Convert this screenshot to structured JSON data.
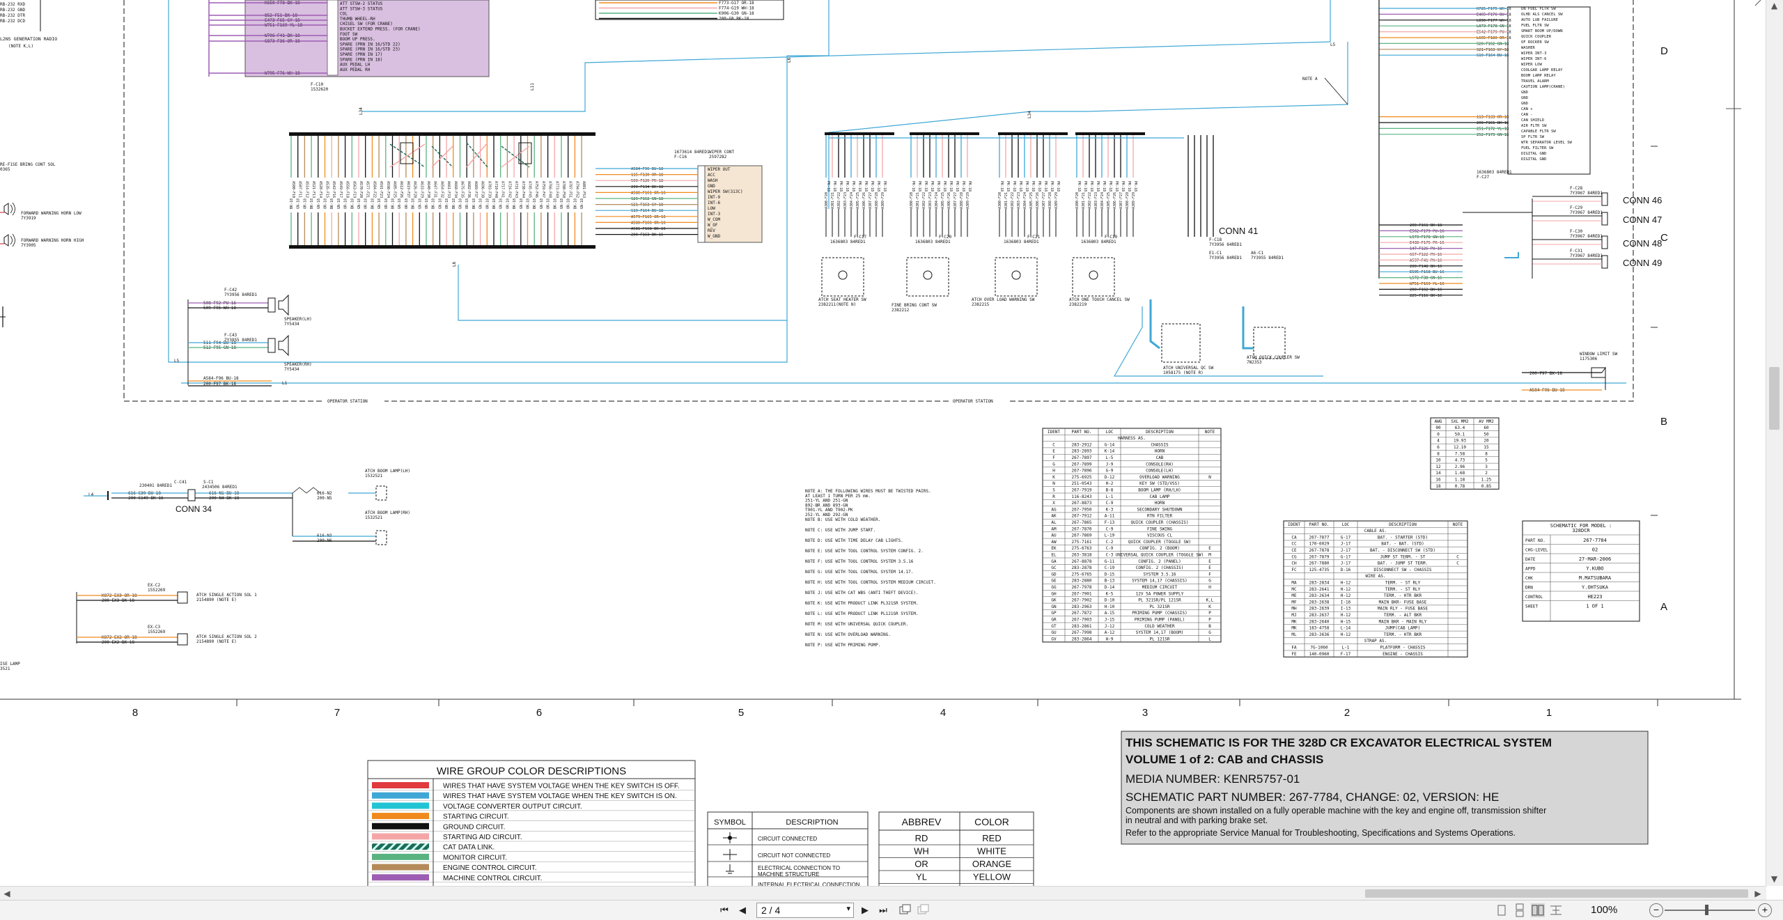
{
  "wire_colors": {
    "red": "#e0393e",
    "blue": "#3fa7d6",
    "cyan": "#22c4d4",
    "orange": "#f08a1c",
    "black": "#111111",
    "pink": "#f4a6a6",
    "dashed": "#1a6b5a",
    "green": "#59b380",
    "brown": "#b58a5a",
    "purple": "#9d5db3"
  },
  "fragments": {
    "top_left": [
      "RB-232 RXD",
      "RB-232 GND",
      "RB-232 DTR",
      "RB-232 DCD",
      "L2NS GENERATION RADIO",
      "(NOTE K,L)"
    ],
    "purple_labels": [
      "ATT STSW-2 STATUS",
      "ATT STSW-3 STATUS",
      "COL",
      "THUMB WHEEL-RH",
      "CHISEL SW (FOR CRANE)",
      "BUCKET EXTEND PRESS. (FOR CRANE)",
      "FOOT SW",
      "BOOM UP PRESS.",
      "SPARE (PRN IN 16/STD 22)",
      "SPARE (PRN IN 16/STD 23)",
      "SPARE (PRN IN 17)",
      "SPARE (PRN IN 18)",
      "AUX PEDAL LH",
      "AUX PEDAL RH"
    ],
    "purple_wires": [
      "K650-F73  BK-18",
      "852-F51  BK-18",
      "E473-F65  GY-18",
      "W751-F169  YL-18",
      "W706-F41  BK-18",
      "G873-F36  OR-18",
      "W795-F76  WH-18"
    ],
    "purple_ref": [
      "F-C10",
      "1532620"
    ],
    "top_middle": [
      "F773-G17  OR-18",
      "F774-G19  WH-18",
      "K906-G30  GN-18",
      "200-G8  BK-18"
    ],
    "left_side": [
      "RE-F1SE BRING CONT SOL",
      "0365",
      "FORWARD WARNING HORN LOW",
      "7Y3919",
      "FORWARD WARNING HORN HIGH",
      "7Y3905"
    ],
    "wiper_cont": [
      "WIPER CONT",
      "2597282",
      "1673614 84RED1",
      "F-C16"
    ],
    "wiper_pins": [
      "WIPER OUT",
      "ACC",
      "WASH",
      "GND",
      "WIPER SW(313C)",
      "INT-9",
      "INT-6",
      "LOW",
      "INT-3",
      "W_COM",
      "W_OF",
      "REV",
      "W_GND"
    ],
    "wiper_wires": [
      "A584-F96  BU-18",
      "115-F130  OR-18",
      "500-F130  PK-18",
      "200-F134  BK-18",
      "A586-F161  OR-16",
      "S20-F162  GN-18",
      "S21-F163  GY-18",
      "S19-F164  BU-18",
      "A579-F165  OR-16",
      "A580-F166  OR-16",
      "A581-F168  BK-16",
      "200-F163  BK-16"
    ],
    "speakers": [
      "F-C42",
      "7Y3956 84RED1",
      "508-F92  PU-16",
      "509-F95  WH-18",
      "SPEAKER(LH)",
      "7Y5434",
      "F-C43",
      "7Y3955 84RED1",
      "511-F94  BU-18",
      "512-F95  GN-18",
      "SPEAKER(RH)",
      "7Y5434",
      "A584-F96  BU-18",
      "200-F97  BK-18"
    ],
    "switches": [
      "ATCH SEAT HEATER SW",
      "2382211(NOTE N)",
      "FINE BRING CONT SW",
      "2382212",
      "ATCH OVER LOAD WARNING SW",
      "2382215",
      "ATCH ONE TOUCH CANCEL SW",
      "2382219"
    ],
    "switch_refs": [
      "F-C17",
      "1636803 84RED1",
      "F-C20",
      "1636803 84RED1",
      "F-C21",
      "1636803 84RED1",
      "F-C19",
      "1636803 84RED1"
    ],
    "conn41": "CONN 41",
    "conn41_refs": [
      "F-C18",
      "7Y3956 84RED1",
      "E1-C1",
      "7Y3956 84RED1",
      "A6-C1",
      "7Y3955 84RED1"
    ],
    "attach_sw": [
      "ATCH UNIVERSAL QC SW",
      "1058175 (NOTE R)",
      "ATCH QUICK COUPLER SW",
      "7N2353"
    ],
    "operator_station": "OPERATOR STATION",
    "right_labels": [
      "EN FUEL FLTR SW",
      "OLHD ALS CANCEL SW",
      "AUTO LUB FAILURE",
      "FUEL FLTR SW",
      "SMART BOOM UP/DOWN",
      "QUICK COUPLER",
      "OF ROCKER SW",
      "WASHER",
      "WIPER INT-3",
      "WIPER INT-6",
      "WIPER LOW",
      "COOLGAR LAMP RELAY",
      "BOOM LAMP RELAY",
      "TRAVEL ALARM",
      "CAUTION LAMP(CRANE)",
      "GND",
      "GND",
      "GND",
      "CAN +",
      "CAN -",
      "CAN SHIELD",
      "AIR FLTR SW",
      "CAPABLE FLTR SW",
      "SP FLTR SW",
      "WTR SEPARATOR LEVEL SW",
      "FUEL FILTER SW",
      "DIGITAL GND",
      "DIGITAL GND"
    ],
    "right_wires": [
      "K725-F175  WH-18",
      "E465-F176  BU-18",
      "L896-F177  WH-18",
      "L873-F178  GN-18",
      "E542-F179  PU-18",
      "L665-F180  OR-18",
      "S20-F162  GN-18",
      "S21-F163  GY-18",
      "S19-F164  BU-18",
      "113-F133  OR-18",
      "200-F161  BK-18",
      "251-F172  YL-18",
      "252-F173  GN-18"
    ],
    "note_a": "NOTE A",
    "conn_refs_right": [
      "F-C27",
      "1636803 84RED1",
      "F-C28",
      "7Y3967 84RED1",
      "F-C29",
      "7Y3967 84RED1",
      "F-C30",
      "7Y3967 84RED1",
      "F-C31",
      "7Y3967 84RED1"
    ],
    "right_lower_wires": [
      "200-F161  BK-18",
      "E562-F179  PU-16",
      "L573-F178  GN-16",
      "E438-F175  PK-16",
      "147-F126  PU-16",
      "667-F122  PK-16",
      "A537-F41  PK-16",
      "200-F148  BK-16",
      "E505-F168  BU-16",
      "L572-F38  GN-16",
      "W751-F169  YL-16",
      "200-F162  BK-16",
      "225-F116  BK-16"
    ],
    "conn_right": [
      "CONN 46",
      "CONN 47",
      "CONN 48",
      "CONN 49"
    ],
    "window_limit": [
      "WINDOW LIMIT SW",
      "1175306",
      "200-F97  BK-18",
      "A584-F96  BU-18"
    ],
    "conn34": "CONN 34",
    "conn34_wires": [
      "230401 84RED1",
      "616-C30  BU-18",
      "200-C149  BK-16",
      "C-C41",
      "2434506 84RED1",
      "S-C1",
      "616-N1  BU-18",
      "200-N4  BK-18",
      "616-N2",
      "200-N5",
      "616-N3",
      "200-N6"
    ],
    "boom_lamps": [
      "ATCH BOOM LAMP(LH)",
      "1532521",
      "ATCH BOOM LAMP(RH)",
      "1532521"
    ],
    "sols": [
      "EX-C2",
      "1552269",
      "K872-EX3  OR-18",
      "200-EX3  BK-18",
      "ATCH SINGLE ACTION SOL 1",
      "2154890  (NOTE E)",
      "EX-C3",
      "1552269",
      "K872-EX2  OR-18",
      "200-EX2  BK-18",
      "ATCH SINGLE ACTION SOL 2",
      "2154890  (NOTE E)"
    ],
    "lamp_left": [
      "ISE LAMP",
      "3521"
    ],
    "ref_l_labels": [
      "L1",
      "L5",
      "L6",
      "L6",
      "L5",
      "L4",
      "L34",
      "L34"
    ],
    "zone_letters": [
      "D",
      "C",
      "B",
      "A"
    ],
    "grid_numbers": [
      "8",
      "7",
      "6",
      "5",
      "4",
      "3",
      "2",
      "1"
    ]
  },
  "notes": [
    "NOTE A: THE FOLLOWING WIRES MUST BE TWISTED PAIRS.",
    "    AT LEAST 1 TURN PER 25 mm.",
    "    251-YL AND 251-GN",
    "    892-BR AND 893-GN",
    "    T901-YL AND T902-PK",
    "    252-YL AND 292-GN",
    "NOTE B: USE WITH COLD WEATHER.",
    "NOTE C: USE WITH JUMP START.",
    "NOTE D: USE WITH TIME DELAY CAB LIGHTS.",
    "NOTE E: USE WITH TOOL CONTROL SYSTEM CONFIG. 2.",
    "NOTE F: USE WITH TOOL CONTROL SYSTEM 3.5.16",
    "NOTE G: USE WITH TOOL CONTROL SYSTEM 14.17.",
    "NOTE H: USE WITH TOOL CONTROL SYSTEM MEDIUM CIRCUIT.",
    "NOTE J: USE WITH CAT WBS (ANTI THEFT DEVICE).",
    "NOTE K: USE WITH PRODUCT LINK PL321SR SYSTEM.",
    "NOTE L: USE WITH PRODUCT LINK PL121SR SYSTEM.",
    "NOTE M: USE WITH UNIVERSAL QUICK COUPLER.",
    "NOTE N: USE WITH OVERLOAD WARNING.",
    "NOTE P: USE WITH PRIMING PUMP."
  ],
  "harness_table": {
    "headers": [
      "IDENT",
      "PART NO.",
      "LOC",
      "DESCRIPTION",
      "NOTE"
    ],
    "section": "HARNESS AS.",
    "rows": [
      [
        "C",
        "283-2912",
        "G-14",
        "CHASSIS",
        ""
      ],
      [
        "E",
        "283-2893",
        "K-14",
        "HORN",
        ""
      ],
      [
        "F",
        "267-7897",
        "L-5",
        "CAB",
        ""
      ],
      [
        "G",
        "267-7899",
        "J-9",
        "CONSOLE(RH)",
        ""
      ],
      [
        "H",
        "267-7896",
        "G-9",
        "CONSOLE(LH)",
        ""
      ],
      [
        "K",
        "275-6925",
        "D-12",
        "OVERLOAD WARNING",
        "N"
      ],
      [
        "N",
        "251-0543",
        "H-2",
        "KEY SW (STD/VSS)",
        ""
      ],
      [
        "S",
        "267-7919",
        "B-8",
        "BOOM LAMP (RH/LH)",
        ""
      ],
      [
        "R",
        "116-8243",
        "L-1",
        "CAB LAMP",
        ""
      ],
      [
        "X",
        "267-8873",
        "C-9",
        "HORN",
        ""
      ],
      [
        "AG",
        "267-7950",
        "K-3",
        "SECONDARY SHUTDOWN",
        ""
      ],
      [
        "AK",
        "267-7912",
        "A-11",
        "RTN FILTER",
        ""
      ],
      [
        "AL",
        "267-7865",
        "F-13",
        "QUICK COUPLER (CHASSIS)",
        ""
      ],
      [
        "AM",
        "267-7870",
        "C-9",
        "FINE SWING",
        ""
      ],
      [
        "AU",
        "267-7869",
        "L-19",
        "VISCOUS CL",
        ""
      ],
      [
        "AW",
        "275-7161",
        "C-2",
        "QUICK COUPLER (TOGGLE SW)",
        ""
      ],
      [
        "EK",
        "275-6763",
        "C-9",
        "CONFIG. 2 (BOOM)",
        "E"
      ],
      [
        "EL",
        "263-3818",
        "C-3",
        "UNIVERSAL QUICK COUPLER (TOGGLE SW)",
        "M"
      ],
      [
        "GA",
        "267-8878",
        "G-11",
        "CONFIG. 2 (PANEL)",
        "E"
      ],
      [
        "GC",
        "283-2878",
        "C-19",
        "CONFIG. 2 (CHASSIS)",
        "E"
      ],
      [
        "GD",
        "275-6765",
        "D-15",
        "SYSTEM 3.5.16",
        "F"
      ],
      [
        "GE",
        "283-2880",
        "B-13",
        "SYSTEM 14,17 (CHASSIS)",
        "G"
      ],
      [
        "GG",
        "267-7978",
        "D-14",
        "MEDIUM CIRCUIT",
        "H"
      ],
      [
        "GH",
        "267-7901",
        "K-5",
        "12V 5A POWER SUPPLY",
        ""
      ],
      [
        "GK",
        "267-7902",
        "D-10",
        "PL 321SR/PL 121SR",
        "K,L"
      ],
      [
        "GN",
        "283-2963",
        "H-10",
        "PL 321SR",
        "K"
      ],
      [
        "GP",
        "267-7872",
        "A-15",
        "PRIMING PUMP (CHASSIS)",
        "P"
      ],
      [
        "GR",
        "267-7903",
        "J-15",
        "PRIMING PUMP (PANEL)",
        "P"
      ],
      [
        "GT",
        "283-2861",
        "J-12",
        "COLD WEATHER",
        "B"
      ],
      [
        "GU",
        "267-7998",
        "A-12",
        "SYSTEM 14,17 (BOOM)",
        "G"
      ],
      [
        "GV",
        "283-2864",
        "H-9",
        "PL 121SR",
        "L"
      ]
    ]
  },
  "awg_table": {
    "headers": [
      "AWG",
      "SXL MM2",
      "AV MM2"
    ],
    "rows": [
      [
        "00",
        "63.4",
        "60"
      ],
      [
        "0",
        "50.1",
        "50"
      ],
      [
        "4",
        "19.93",
        "20"
      ],
      [
        "6",
        "12.10",
        "15"
      ],
      [
        "8",
        "7.58",
        "8"
      ],
      [
        "10",
        "4.73",
        "5"
      ],
      [
        "12",
        "2.96",
        "3"
      ],
      [
        "14",
        "1.68",
        "2"
      ],
      [
        "16",
        "1.18",
        "1.25"
      ],
      [
        "18",
        "0.78",
        "0.85"
      ]
    ]
  },
  "cable_table": {
    "headers": [
      "IDENT",
      "PART NO.",
      "LOC",
      "DESCRIPTION",
      "NOTE"
    ],
    "sections": [
      {
        "title": "CABLE AS.",
        "rows": [
          [
            "CA",
            "267-7877",
            "G-17",
            "BAT. - STARTER (STD)",
            ""
          ],
          [
            "CC",
            "170-6029",
            "J-17",
            "BAT. - BAT. (STD)",
            ""
          ],
          [
            "CE",
            "267-7878",
            "J-17",
            "BAT. - DISCONNECT SW (STD)",
            ""
          ],
          [
            "CG",
            "267-7879",
            "G-17",
            "JUMP ST TERM. - ST",
            "C"
          ],
          [
            "CH",
            "267-7880",
            "J-17",
            "BAT. - JUMP ST TERM.",
            "C"
          ],
          [
            "FC",
            "125-4735",
            "D-16",
            "DISCONNECT SW - CHASSIS",
            ""
          ]
        ]
      },
      {
        "title": "WIRE AS.",
        "rows": [
          [
            "MA",
            "283-2834",
            "H-12",
            "TERM. - ST RLY",
            ""
          ],
          [
            "MC",
            "283-2641",
            "H-12",
            "TERM. - ST RLY",
            ""
          ],
          [
            "ME",
            "283-2634",
            "H-12",
            "TERM. - HTR BKR",
            ""
          ],
          [
            "MF",
            "283-2638",
            "I-16",
            "MAIN BKR- FUSE BASE",
            ""
          ],
          [
            "MH",
            "283-2639",
            "I-13",
            "MAIN RLY - FUSE BASE",
            ""
          ],
          [
            "MJ",
            "283-2637",
            "H-12",
            "TERM. - ALT BKR",
            ""
          ],
          [
            "MK",
            "283-2640",
            "H-15",
            "MAIN BKR - MAIN RLY",
            ""
          ],
          [
            "MK",
            "183-4758",
            "L-14",
            "JUMP(CAB LAMP)",
            ""
          ],
          [
            "ML",
            "283-2636",
            "H-12",
            "TERM. - HTR BKR",
            ""
          ]
        ]
      },
      {
        "title": "STRAP AS.",
        "rows": [
          [
            "FA",
            "7G-1060",
            "L-1",
            "PLATFORM - CHASSIS",
            ""
          ],
          [
            "FE",
            "140-0960",
            "F-17",
            "ENGINE - CHASSIS",
            ""
          ]
        ]
      }
    ]
  },
  "title_block": {
    "heading": "SCHEMATIC FOR MODEL :",
    "model": "328DCR",
    "rows": [
      [
        "PART NO.",
        "267-7784"
      ],
      [
        "CHG-LEVEL",
        "02"
      ],
      [
        "DATE",
        "27-MAR-2006"
      ],
      [
        "APPD",
        "Y.KUBO"
      ],
      [
        "CHK",
        "M.MATSUBARA"
      ],
      [
        "DRN",
        "Y.OHTSUKA"
      ],
      [
        "CONTROL",
        "HE223"
      ],
      [
        "SHEET",
        "1 OF 1"
      ]
    ]
  },
  "info_box": {
    "line1": "THIS SCHEMATIC IS FOR THE 328D CR EXCAVATOR ELECTRICAL SYSTEM",
    "line2": "VOLUME 1 of 2: CAB and CHASSIS",
    "line3": "MEDIA NUMBER: KENR5757-01",
    "line4": "SCHEMATIC PART NUMBER: 267-7784, CHANGE: 02, VERSION: HE",
    "line5": "Components are shown installed on a fully operable machine with the key and engine off, transmission shifter",
    "line6": "in neutral and with parking brake set.",
    "line7": "Refer to the appropriate Service Manual for Troubleshooting, Specifications and Systems Operations."
  },
  "wire_group": {
    "title": "WIRE GROUP COLOR DESCRIPTIONS",
    "items": [
      {
        "color": "#e0393e",
        "style": "solid",
        "label": "WIRES THAT HAVE SYSTEM VOLTAGE WHEN THE KEY SWITCH IS OFF."
      },
      {
        "color": "#3fa7d6",
        "style": "solid",
        "label": "WIRES THAT HAVE SYSTEM VOLTAGE WHEN THE KEY SWITCH IS ON."
      },
      {
        "color": "#22c4d4",
        "style": "solid",
        "label": "VOLTAGE CONVERTER OUTPUT CIRCUIT."
      },
      {
        "color": "#f08a1c",
        "style": "solid",
        "label": "STARTING CIRCUIT."
      },
      {
        "color": "#111111",
        "style": "solid",
        "label": "GROUND CIRCUIT."
      },
      {
        "color": "#f4a6a6",
        "style": "solid",
        "label": "STARTING AID CIRCUIT."
      },
      {
        "color": "#1a6b5a",
        "style": "hatch",
        "label": "CAT DATA LINK."
      },
      {
        "color": "#59b380",
        "style": "solid",
        "label": "MONITOR CIRCUIT."
      },
      {
        "color": "#b58a5a",
        "style": "solid",
        "label": "ENGINE CONTROL CIRCUIT."
      },
      {
        "color": "#9d5db3",
        "style": "solid",
        "label": "MACHINE CONTROL CIRCUIT."
      }
    ]
  },
  "symbol_table": {
    "headers": [
      "SYMBOL",
      "DESCRIPTION"
    ],
    "rows": [
      [
        "CIRCUIT CONNECTED"
      ],
      [
        "CIRCUIT NOT CONNECTED"
      ],
      [
        "ELECTRICAL CONNECTION TO",
        "MACHINE STRUCTURE"
      ],
      [
        "INTERNAL ELECTRICAL CONNECTION"
      ]
    ]
  },
  "abbrev_table": {
    "headers": [
      "ABBREV",
      "COLOR"
    ],
    "rows": [
      [
        "RD",
        "RED"
      ],
      [
        "WH",
        "WHITE"
      ],
      [
        "OR",
        "ORANGE"
      ],
      [
        "YL",
        "YELLOW"
      ]
    ]
  },
  "statusbar": {
    "page_value": "2 / 4",
    "zoom": "100%",
    "first_page": "⏮",
    "prev_page": "◀",
    "next_page": "▶",
    "last_page": "⏭",
    "zoom_out": "−",
    "zoom_in": "+",
    "dropdown": "▾"
  }
}
